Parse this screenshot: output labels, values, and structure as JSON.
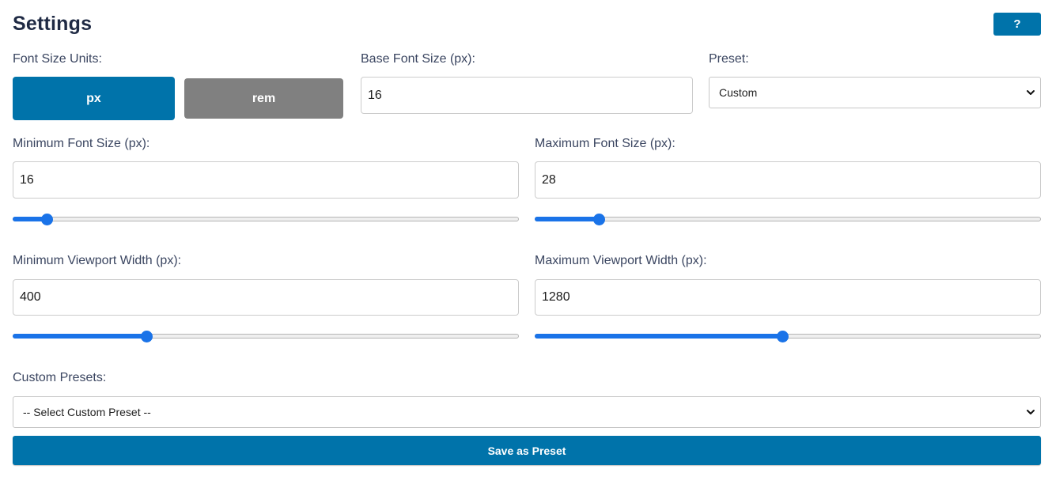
{
  "header": {
    "title": "Settings",
    "help_label": "?"
  },
  "units": {
    "label": "Font Size Units:",
    "options": [
      "px",
      "rem"
    ],
    "selected": "px"
  },
  "base_font": {
    "label": "Base Font Size (px):",
    "value": "16"
  },
  "preset": {
    "label": "Preset:",
    "selected": "Custom"
  },
  "min_font": {
    "label": "Minimum Font Size (px):",
    "value": "16",
    "slider_fraction": 0.065
  },
  "max_font": {
    "label": "Maximum Font Size (px):",
    "value": "28",
    "slider_fraction": 0.125
  },
  "min_viewport": {
    "label": "Minimum Viewport Width (px):",
    "value": "400",
    "slider_fraction": 0.262
  },
  "max_viewport": {
    "label": "Maximum Viewport Width (px):",
    "value": "1280",
    "slider_fraction": 0.488
  },
  "custom_presets": {
    "label": "Custom Presets:",
    "selected": "-- Select Custom Preset --"
  },
  "save_label": "Save as Preset",
  "colors": {
    "primary": "#0073aa",
    "inactive": "#808080",
    "slider": "#1a73e8"
  }
}
